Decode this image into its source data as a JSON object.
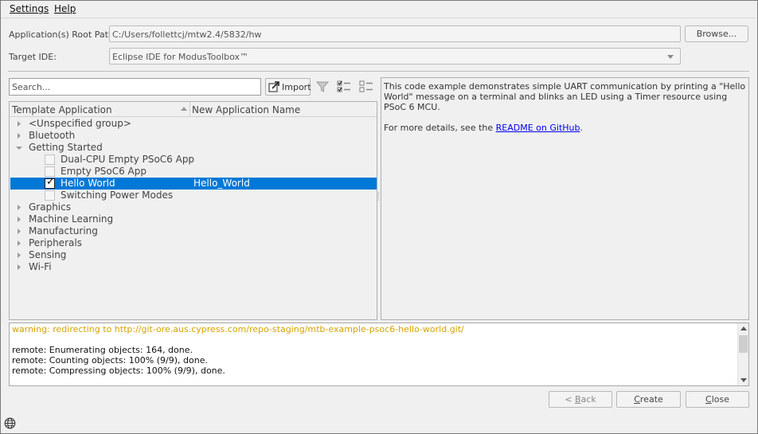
{
  "menu": {
    "settings_prefix": "S",
    "settings_rest": "ettings",
    "help_prefix": "H",
    "help_rest": "elp"
  },
  "form": {
    "root_path_label": "Application(s) Root Path:",
    "root_path_value": "C:/Users/follettcj/mtw2.4/5832/hw",
    "browse_label": "Browse...",
    "target_ide_label": "Target IDE:",
    "target_ide_value": "Eclipse IDE for ModusToolbox™"
  },
  "toolbar": {
    "search_placeholder": "Search...",
    "import_label": "Import"
  },
  "tree": {
    "headers": [
      "Template Application",
      "New Application Name"
    ],
    "rows": [
      {
        "label": "<Unspecified group>",
        "type": "group",
        "expanded": false
      },
      {
        "label": "Bluetooth",
        "type": "group",
        "expanded": false
      },
      {
        "label": "Getting Started",
        "type": "group",
        "expanded": true
      },
      {
        "label": "Dual-CPU Empty PSoC6 App",
        "type": "item",
        "checked": false
      },
      {
        "label": "Empty PSoC6 App",
        "type": "item",
        "checked": false
      },
      {
        "label": "Hello World",
        "type": "item",
        "checked": true,
        "selected": true,
        "new_name": "Hello_World"
      },
      {
        "label": "Switching Power Modes",
        "type": "item",
        "checked": false
      },
      {
        "label": "Graphics",
        "type": "group",
        "expanded": false
      },
      {
        "label": "Machine Learning",
        "type": "group",
        "expanded": false
      },
      {
        "label": "Manufacturing",
        "type": "group",
        "expanded": false
      },
      {
        "label": "Peripherals",
        "type": "group",
        "expanded": false
      },
      {
        "label": "Sensing",
        "type": "group",
        "expanded": false
      },
      {
        "label": "Wi-Fi",
        "type": "group",
        "expanded": false
      }
    ]
  },
  "description": {
    "text": "This code example demonstrates simple UART communication by printing a \"Hello World\" message on a terminal and blinks an LED using a Timer resource using PSoC 6 MCU.",
    "more_prefix": "For more details, see the ",
    "link_text": "README on GitHub",
    "more_suffix": "."
  },
  "log": {
    "lines": [
      {
        "text": "warning: redirecting to http://git-ore.aus.cypress.com/repo-staging/mtb-example-psoc6-hello-world.git/",
        "kind": "warning"
      },
      {
        "text": "",
        "kind": "normal"
      },
      {
        "text": "remote: Enumerating objects: 164, done.",
        "kind": "normal"
      },
      {
        "text": "remote: Counting objects: 100% (9/9), done.",
        "kind": "normal"
      },
      {
        "text": "remote: Compressing objects: 100% (9/9), done.",
        "kind": "normal"
      }
    ]
  },
  "buttons": {
    "back_prefix": "< ",
    "back_key": "B",
    "back_rest": "ack",
    "create_key": "C",
    "create_rest": "reate",
    "close_key": "C",
    "close_rest": "lose"
  },
  "colors": {
    "selection": "#0078d7",
    "warning_text": "#d6a200",
    "link": "#0000ee"
  }
}
